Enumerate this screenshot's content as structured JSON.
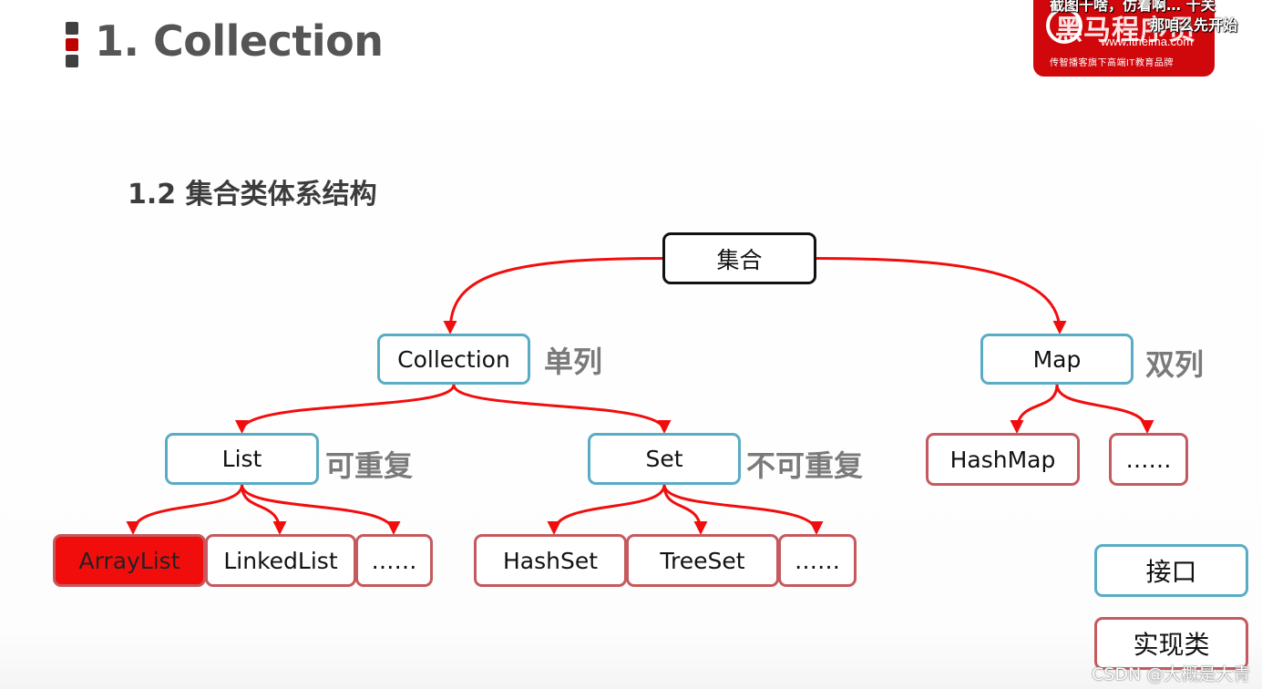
{
  "header": {
    "title": "1. Collection",
    "marker_colors": [
      "#404040",
      "#c00000",
      "#404040"
    ]
  },
  "logo": {
    "brand": "黑马程序员",
    "url": "www.itheima.com",
    "slogan": "传智播客旗下高端IT教育品牌",
    "color": "#d0080c"
  },
  "subtitles": {
    "line1": "截图干啥，仿着啊…  十关",
    "line2": "那咱么先开始"
  },
  "section": {
    "title": "1.2 集合类体系结构"
  },
  "diagram": {
    "root": {
      "label": "集合"
    },
    "collection": {
      "label": "Collection",
      "note": "单列"
    },
    "map": {
      "label": "Map",
      "note": "双列"
    },
    "list": {
      "label": "List",
      "note": "可重复"
    },
    "set": {
      "label": "Set",
      "note": "不可重复"
    },
    "arraylist": {
      "label": "ArrayList",
      "highlighted": true
    },
    "linkedlist": {
      "label": "LinkedList"
    },
    "list_more": {
      "label": "……"
    },
    "hashset": {
      "label": "HashSet"
    },
    "treeset": {
      "label": "TreeSet"
    },
    "set_more": {
      "label": "……"
    },
    "hashmap": {
      "label": "HashMap"
    },
    "map_more": {
      "label": "……"
    },
    "edges": [
      [
        "root",
        "collection"
      ],
      [
        "root",
        "map"
      ],
      [
        "collection",
        "list"
      ],
      [
        "collection",
        "set"
      ],
      [
        "list",
        "arraylist"
      ],
      [
        "list",
        "linkedlist"
      ],
      [
        "list",
        "list_more"
      ],
      [
        "set",
        "hashset"
      ],
      [
        "set",
        "treeset"
      ],
      [
        "set",
        "set_more"
      ],
      [
        "map",
        "hashmap"
      ],
      [
        "map",
        "map_more"
      ]
    ],
    "colors": {
      "edge": "#f20d0d",
      "interface_border": "#5aacc4",
      "impl_border": "#c55a5e",
      "highlight_fill": "#f20d0d"
    }
  },
  "legend": {
    "interface": "接口",
    "implementation": "实现类"
  },
  "watermark": "CSDN @大概是大青"
}
